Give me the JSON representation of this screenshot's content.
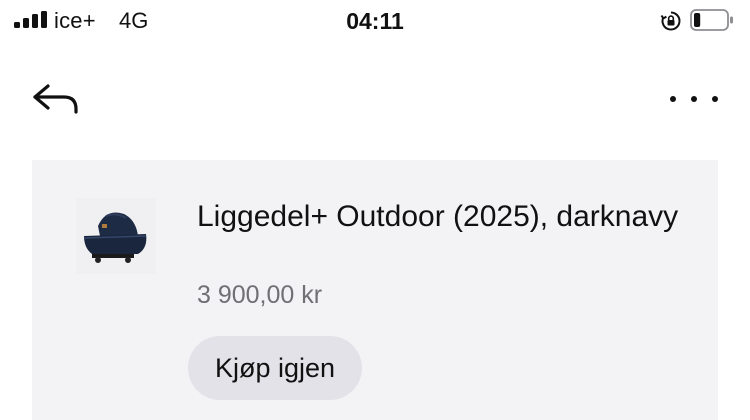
{
  "status_bar": {
    "carrier": "ice+",
    "network": "4G",
    "time": "04:11",
    "signal_bars": 4,
    "battery_level": 0.2,
    "icons": [
      "signal-icon",
      "rotation-lock-icon",
      "battery-icon"
    ]
  },
  "nav": {
    "icons": [
      "back-arrow-icon",
      "more-options-icon"
    ]
  },
  "product": {
    "name": "Liggedel+ Outdoor (2025), darknavy",
    "price": "3 900,00 kr",
    "buy_again_label": "Kjøp igjen",
    "thumbnail_icon": "stroller-carrycot-image"
  },
  "colors": {
    "card_background": "#f3f3f6",
    "button_background": "#e2e2e8",
    "price_text": "#6f6f74",
    "product_navy": "#1e2b45"
  }
}
